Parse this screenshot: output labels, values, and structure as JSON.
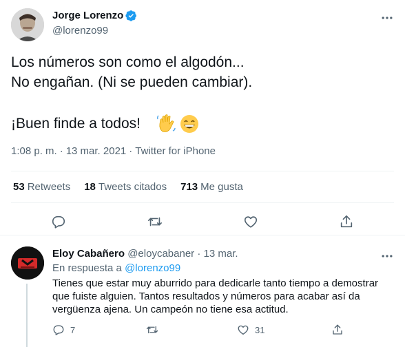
{
  "tweet": {
    "author_name": "Jorge Lorenzo",
    "author_handle": "@lorenzo99",
    "line1": "Los números son como el algodón...",
    "line2": "No engañan. (Ni se pueden cambiar).",
    "line3": "¡Buen finde a todos!",
    "emojis": [
      "waving-hand",
      "grinning-face"
    ],
    "time": "1:08 p. m.",
    "sep": "·",
    "date": "13 mar. 2021",
    "source": "Twitter for iPhone",
    "retweets_count": "53",
    "retweets_label": "Retweets",
    "quotes_count": "18",
    "quotes_label": "Tweets citados",
    "likes_count": "713",
    "likes_label": "Me gusta"
  },
  "reply": {
    "author_name": "Eloy Cabañero",
    "author_handle": "@eloycabaner",
    "sep": "·",
    "date": "13 mar.",
    "in_reply_prefix": "En respuesta a",
    "in_reply_handle": "@lorenzo99",
    "text": "Tienes que estar muy aburrido para dedicarle tanto tiempo a demostrar que fuiste alguien. Tantos resultados y números para acabar así da vergüenza ajena. Un campeón no tiene esa actitud.",
    "reply_count": "7",
    "retweet_count": "",
    "like_count": "31"
  },
  "colors": {
    "accent": "#1d9bf0",
    "text": "#0f1419",
    "secondary": "#536471",
    "divider": "#eff3f4"
  }
}
